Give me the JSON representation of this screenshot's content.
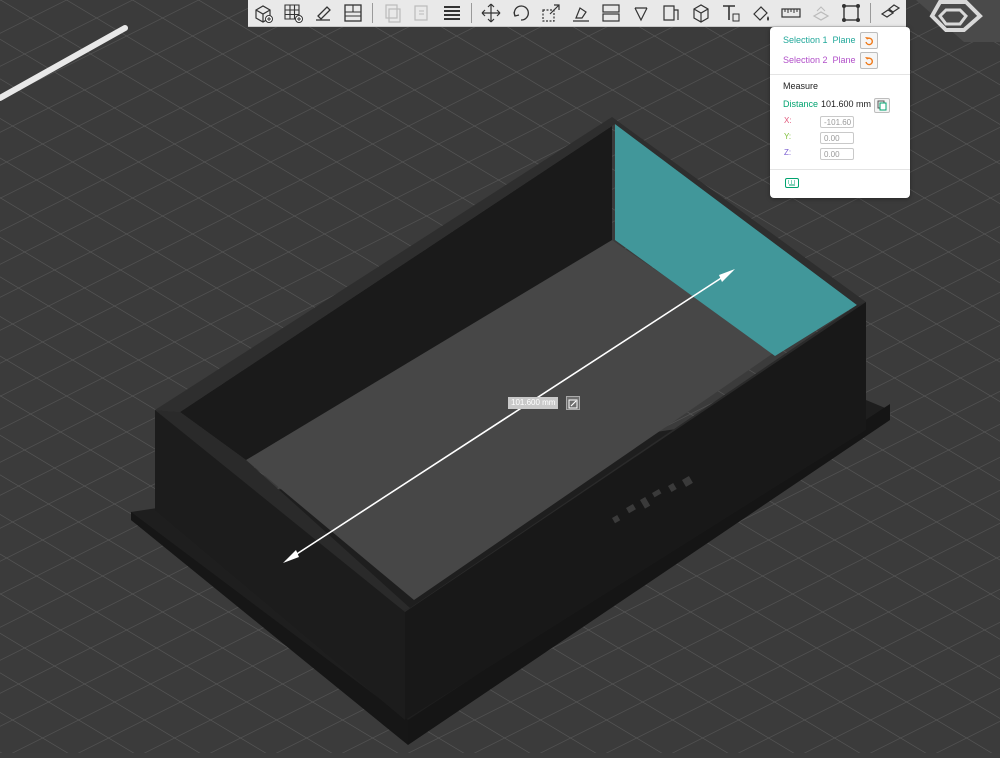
{
  "panel": {
    "selection1_label": "Selection 1",
    "selection1_type": "Plane",
    "selection2_label": "Selection 2",
    "selection2_type": "Plane",
    "measure_title": "Measure",
    "distance_label": "Distance",
    "distance_value": "101.600 mm",
    "x_label": "X:",
    "x_value": "-101.60",
    "y_label": "Y:",
    "y_value": "0.00",
    "z_label": "Z:",
    "z_value": "0.00"
  },
  "viewport": {
    "dimension_label": "101.600 mm"
  },
  "colors": {
    "selection1": "#21a89a",
    "selection2": "#b24fc9",
    "accent": "#00a36f",
    "reset_icon": "#f07a1a",
    "highlight_face": "#41979a",
    "x_axis": "#e0567a",
    "y_axis": "#7fbf3a",
    "z_axis": "#7a5ed1"
  },
  "toolbar_icons": [
    "add-cube-icon",
    "grid-plus-icon",
    "paint-brush-icon",
    "layout-icon",
    "copy-icon",
    "copy-alt-icon",
    "layers-icon",
    "move-icon",
    "rotate-icon",
    "scale-icon",
    "place-on-face-icon",
    "split-icon",
    "cut-icon",
    "support-paint-icon",
    "box-3d-icon",
    "text-icon",
    "color-paint-icon",
    "measure-ruler-icon",
    "assembly-icon",
    "frame-select-icon",
    "explode-icon"
  ]
}
